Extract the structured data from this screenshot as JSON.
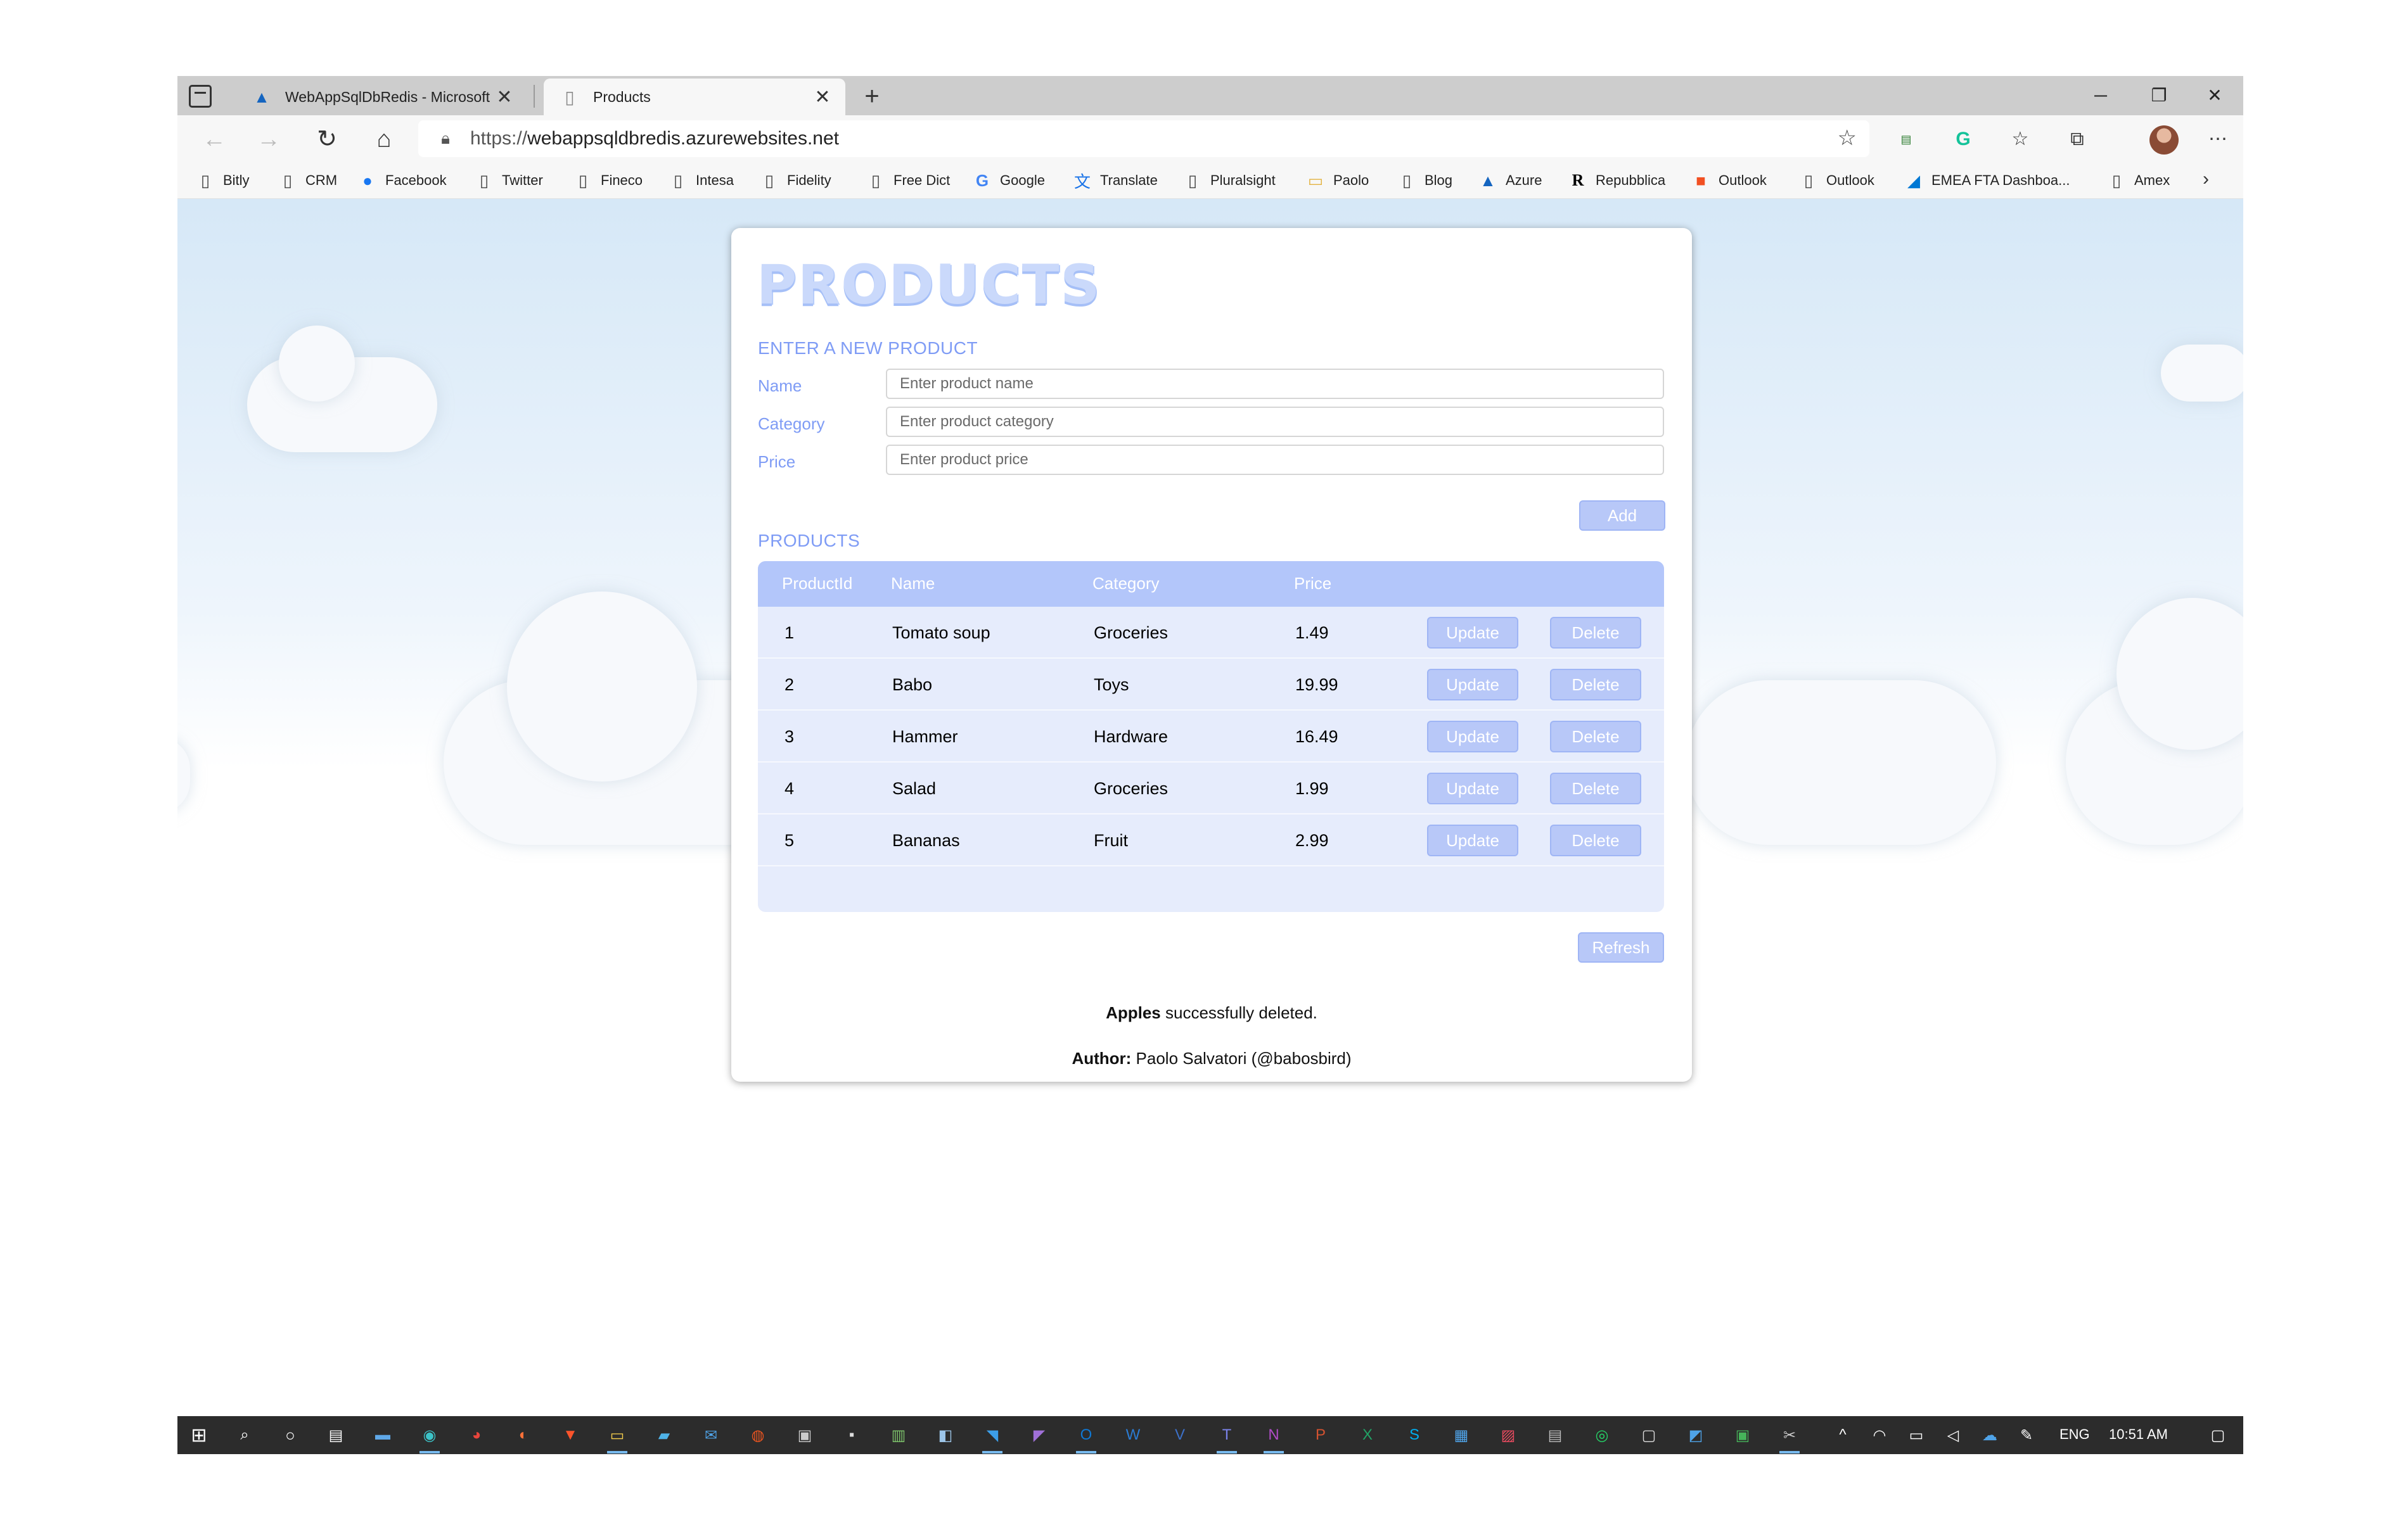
{
  "browser": {
    "tabs": [
      {
        "title": "WebAppSqlDbRedis - Microsoft",
        "icon": "azure-icon"
      },
      {
        "title": "Products",
        "icon": "page-icon"
      }
    ],
    "url_protocol": "https://",
    "url_host": "webappsqldbredis.azurewebsites.net"
  },
  "favorites": [
    {
      "label": "Bitly",
      "icon": "page-icon"
    },
    {
      "label": "CRM",
      "icon": "page-icon"
    },
    {
      "label": "Facebook",
      "icon": "facebook-icon"
    },
    {
      "label": "Twitter",
      "icon": "page-icon"
    },
    {
      "label": "Fineco",
      "icon": "page-icon"
    },
    {
      "label": "Intesa",
      "icon": "page-icon"
    },
    {
      "label": "Fidelity",
      "icon": "page-icon"
    },
    {
      "label": "Free Dict",
      "icon": "page-icon"
    },
    {
      "label": "Google",
      "icon": "google-icon"
    },
    {
      "label": "Translate",
      "icon": "translate-icon"
    },
    {
      "label": "Pluralsight",
      "icon": "page-icon"
    },
    {
      "label": "Paolo",
      "icon": "folder-icon"
    },
    {
      "label": "Blog",
      "icon": "page-icon"
    },
    {
      "label": "Azure",
      "icon": "azure-icon"
    },
    {
      "label": "Repubblica",
      "icon": "repubblica-icon"
    },
    {
      "label": "Outlook",
      "icon": "microsoft-icon"
    },
    {
      "label": "Outlook",
      "icon": "page-icon"
    },
    {
      "label": "EMEA FTA Dashboa...",
      "icon": "devops-icon"
    },
    {
      "label": "Amex",
      "icon": "page-icon"
    }
  ],
  "page": {
    "logo_text": "PRODUCTS",
    "form": {
      "section_title": "ENTER A NEW PRODUCT",
      "name_label": "Name",
      "name_placeholder": "Enter product name",
      "category_label": "Category",
      "category_placeholder": "Enter product category",
      "price_label": "Price",
      "price_placeholder": "Enter product price",
      "add_label": "Add"
    },
    "table": {
      "section_title": "PRODUCTS",
      "columns": [
        "ProductId",
        "Name",
        "Category",
        "Price"
      ],
      "update_label": "Update",
      "delete_label": "Delete",
      "rows": [
        {
          "id": "1",
          "name": "Tomato soup",
          "category": "Groceries",
          "price": "1.49"
        },
        {
          "id": "2",
          "name": "Babo",
          "category": "Toys",
          "price": "19.99"
        },
        {
          "id": "3",
          "name": "Hammer",
          "category": "Hardware",
          "price": "16.49"
        },
        {
          "id": "4",
          "name": "Salad",
          "category": "Groceries",
          "price": "1.99"
        },
        {
          "id": "5",
          "name": "Bananas",
          "category": "Fruit",
          "price": "2.99"
        }
      ]
    },
    "refresh_label": "Refresh",
    "status": {
      "item": "Apples",
      "message": "successfully deleted."
    },
    "footer": {
      "author_label": "Author:",
      "author_value": "Paolo Salvatori (@babosbird)"
    }
  },
  "taskbar": {
    "language": "ENG",
    "time": "10:51 AM"
  },
  "colors": {
    "accent": "#7f9cf5",
    "header": "#b3c6fa",
    "button": "#b8c8f8",
    "grid_bg": "#e6ecfc"
  }
}
